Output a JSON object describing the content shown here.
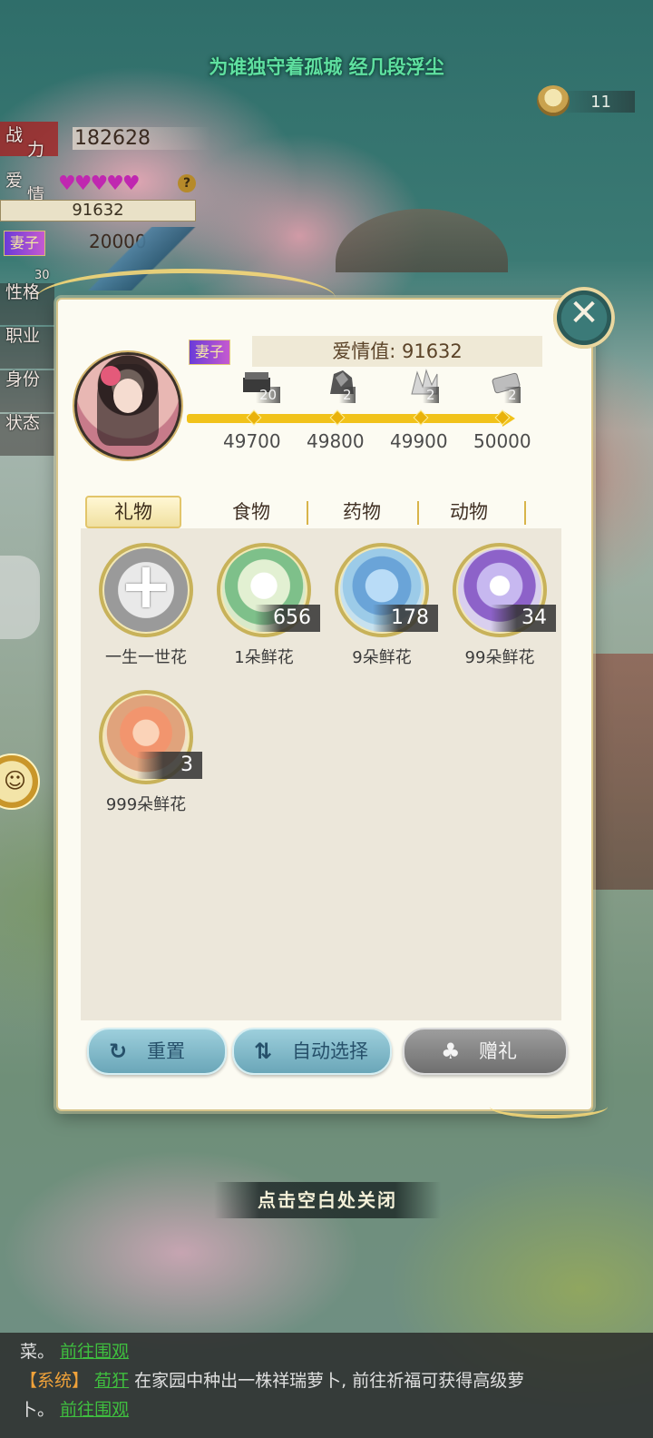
{
  "banner": {
    "song": "为谁独守着孤城 经几段浮尘",
    "tea_count": "11"
  },
  "side": {
    "power_label_1": "战",
    "power_label_2": "力",
    "power_value": "182628",
    "love_label_1": "爱",
    "love_label_2": "情",
    "hearts": "♥♥♥♥♥",
    "help": "?",
    "love_value": "91632",
    "wife_tag": "妻子",
    "wife_value": "20000",
    "level_value": "30",
    "rows": [
      "性格",
      "职业",
      "身份",
      "状态"
    ]
  },
  "dialog": {
    "wife_tag": "妻子",
    "love_label": "爱情值: 91632",
    "rewards": [
      {
        "icon": "chest-icon",
        "count": "20",
        "milestone": "49700"
      },
      {
        "icon": "ore-icon",
        "count": "2",
        "milestone": "49800"
      },
      {
        "icon": "crystal-icon",
        "count": "2",
        "milestone": "49900"
      },
      {
        "icon": "scroll-icon",
        "count": "2",
        "milestone": "50000"
      }
    ],
    "tabs": [
      {
        "label": "礼物",
        "active": true
      },
      {
        "label": "食物",
        "active": false
      },
      {
        "label": "药物",
        "active": false
      },
      {
        "label": "动物",
        "active": false
      }
    ],
    "items": [
      {
        "name": "一生一世花",
        "qty": ""
      },
      {
        "name": "1朵鲜花",
        "qty": "656"
      },
      {
        "name": "9朵鲜花",
        "qty": "178"
      },
      {
        "name": "99朵鲜花",
        "qty": "34"
      },
      {
        "name": "999朵鲜花",
        "qty": "3"
      }
    ],
    "buttons": {
      "reset": "重置",
      "auto": "自动选择",
      "gift": "赠礼"
    }
  },
  "close_hint": "点击空白处关闭",
  "chat": {
    "line1_text": "菜。",
    "line1_link": "前往围观",
    "line2_sys": "【系统】",
    "line2_name": "荀犴",
    "line2_text": "在家园中种出一株祥瑞萝卜, 前往祈福可获得高级萝",
    "line3_text": "卜。",
    "line3_link": "前往围观"
  },
  "colors": {
    "accent_gold": "#f1c21a",
    "tab_active": "#f0e0a0",
    "button_blue": "#6aa6b8",
    "button_gray": "#6f6f6f"
  }
}
